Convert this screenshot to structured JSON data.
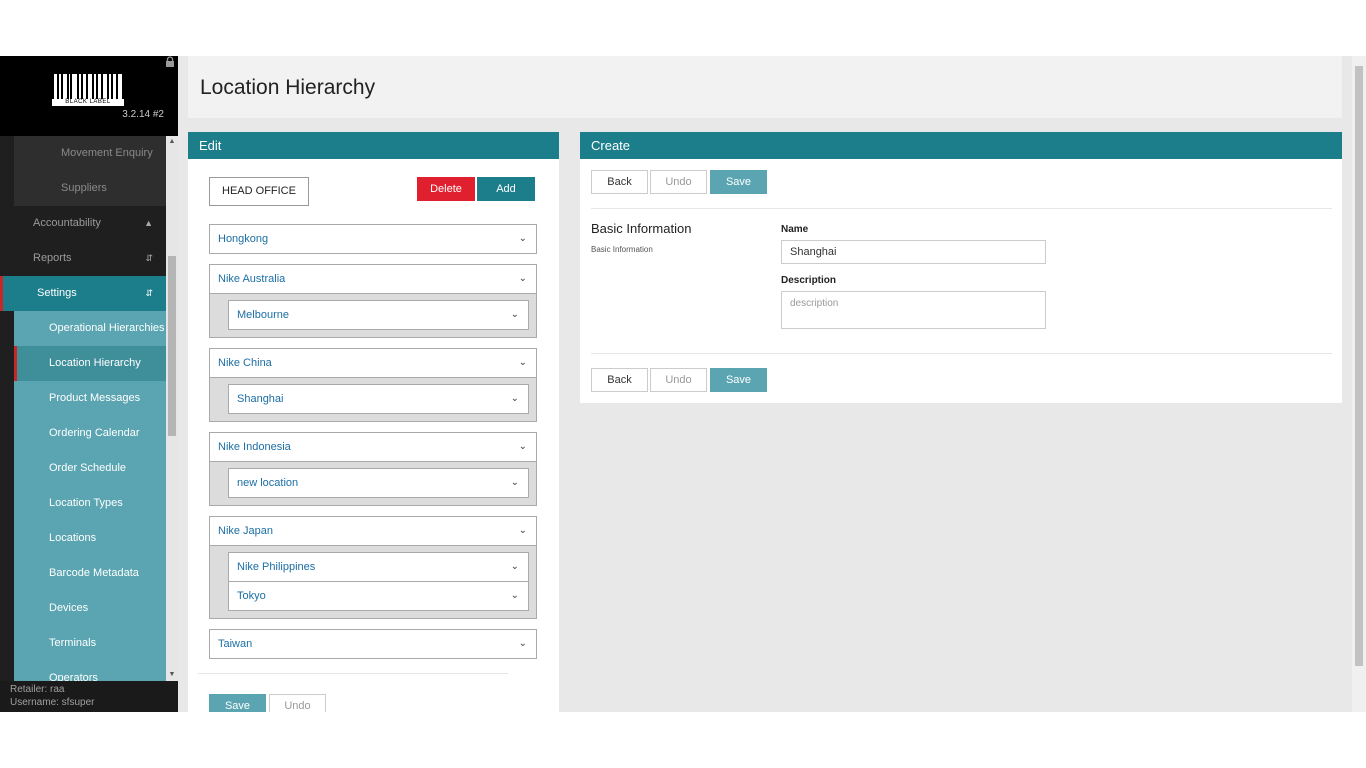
{
  "app": {
    "version": "3.2.14 #2",
    "logo_text": "BLACK LABEL",
    "retailer": "Retailer: raa",
    "username": "Username: sfsuper"
  },
  "sidebar": {
    "items": [
      {
        "label": "Movement Enquiry"
      },
      {
        "label": "Suppliers"
      },
      {
        "label": "Accountability"
      },
      {
        "label": "Reports"
      },
      {
        "label": "Settings"
      },
      {
        "label": "Operational Hierarchies"
      },
      {
        "label": "Location Hierarchy"
      },
      {
        "label": "Product Messages"
      },
      {
        "label": "Ordering Calendar"
      },
      {
        "label": "Order Schedule"
      },
      {
        "label": "Location Types"
      },
      {
        "label": "Locations"
      },
      {
        "label": "Barcode Metadata"
      },
      {
        "label": "Devices"
      },
      {
        "label": "Terminals"
      },
      {
        "label": "Operators"
      }
    ]
  },
  "page": {
    "title": "Location Hierarchy"
  },
  "edit": {
    "header": "Edit",
    "root": "HEAD OFFICE",
    "delete_label": "Delete",
    "add_label": "Add",
    "nodes": {
      "hongkong": "Hongkong",
      "nike_australia": "Nike Australia",
      "melbourne": "Melbourne",
      "nike_china": "Nike China",
      "shanghai": "Shanghai",
      "nike_indonesia": "Nike Indonesia",
      "new_location": "new location",
      "nike_japan": "Nike Japan",
      "nike_philippines": "Nike Philippines",
      "tokyo": "Tokyo",
      "taiwan": "Taiwan"
    },
    "save_label": "Save",
    "undo_label": "Undo"
  },
  "create": {
    "header": "Create",
    "back_label": "Back",
    "undo_label": "Undo",
    "save_label": "Save",
    "section_title": "Basic Information",
    "section_subtitle": "Basic Information",
    "name_label": "Name",
    "name_value": "Shanghai",
    "description_label": "Description",
    "description_placeholder": "description"
  }
}
